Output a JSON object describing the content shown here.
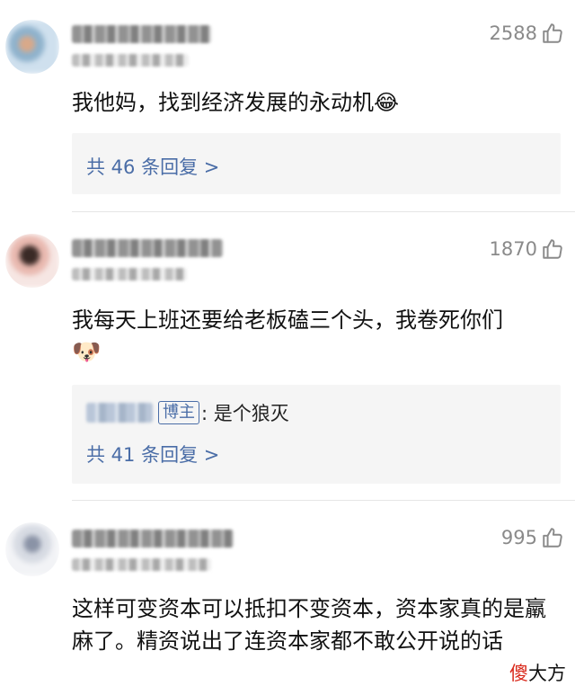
{
  "comments": [
    {
      "likes": "2588",
      "text": "我他妈，找到经济发展的永动机😂",
      "reply_link": "共 46 条回复 >"
    },
    {
      "likes": "1870",
      "text": "我每天上班还要给老板磕三个头，我卷死你们",
      "emoji": "🐶",
      "reply_badge": "博主",
      "reply_text": ": 是个狼灭",
      "reply_link": "共 41 条回复 >"
    },
    {
      "likes": "995",
      "text": "这样可变资本可以抵扣不变资本，资本家真的是羸麻了。精资说出了连资本家都不敢公开说的话"
    }
  ],
  "watermark": {
    "red_char": "傻",
    "rest": "大方"
  },
  "icons": {
    "like": "thumbs-up-outline-icon"
  },
  "colors": {
    "link": "#4a6da7",
    "muted": "#8a8a8a",
    "reply_bg": "#f5f5f5"
  }
}
